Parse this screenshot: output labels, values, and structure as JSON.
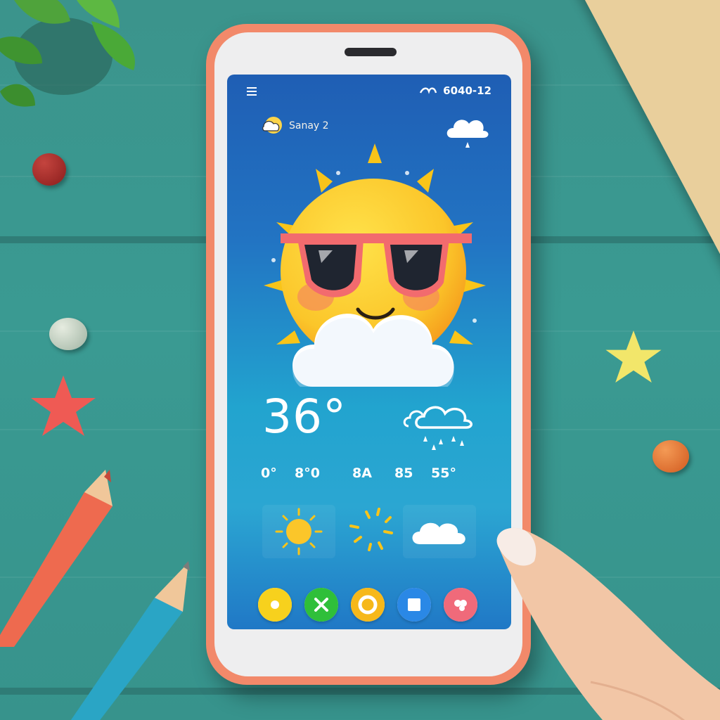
{
  "status_bar": {
    "time_text": "6040-12"
  },
  "header": {
    "location_label": "Sanay 2"
  },
  "current": {
    "temperature": "36°"
  },
  "mini_stats": [
    {
      "label": "0°"
    },
    {
      "label": "8°0"
    },
    {
      "label": "8A"
    },
    {
      "label": "85"
    },
    {
      "label": "55°"
    }
  ],
  "forecast": [
    {
      "icon": "sun-icon"
    },
    {
      "icon": "sun-rays-icon"
    },
    {
      "icon": "cloud-icon"
    }
  ],
  "tab_bar": [
    {
      "icon": "dot-icon",
      "color": "#f7d11d"
    },
    {
      "icon": "x-icon",
      "color": "#2fbf3a"
    },
    {
      "icon": "ring-icon",
      "color": "#f6b81a"
    },
    {
      "icon": "square-icon",
      "color": "#2a88e6"
    },
    {
      "icon": "heart-icon",
      "color": "#f06a7a"
    }
  ],
  "colors": {
    "screen_top": "#1f5eb4",
    "screen_mid": "#22a4cf",
    "phone_case": "#f2896a",
    "sun": "#fbc62a"
  }
}
